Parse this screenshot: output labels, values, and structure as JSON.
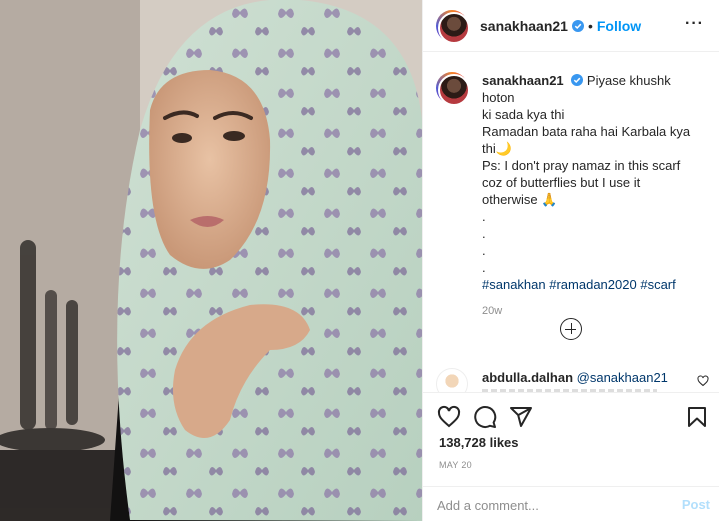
{
  "post": {
    "image_alt": "",
    "author": {
      "username": "sanakhaan21",
      "verified": true,
      "follow_label": "Follow",
      "separator": "•"
    },
    "caption": {
      "username": "sanakhaan21",
      "lines": [
        "Piyase khushk hoton",
        "ki sada kya thi",
        "Ramadan bata raha hai Karbala kya",
        "thi🌙",
        "Ps: I don't pray namaz in this scarf",
        "coz of butterflies but I use it",
        "otherwise 🙏",
        ".",
        ".",
        ".",
        "."
      ],
      "hashtags": [
        "#sanakhan",
        "#ramadan2020",
        "#scarf"
      ],
      "time": "20w"
    },
    "comments": [
      {
        "username": "abdulla.dalhan",
        "text": "@sanakhaan21"
      }
    ],
    "likes": "138,728 likes",
    "date": "MAY 20",
    "add_comment_placeholder": "Add a comment...",
    "post_label": "Post"
  },
  "colors": {
    "accent": "#0095f6",
    "link": "#00376b",
    "muted": "#8e8e8e",
    "post_disabled": "#b2dffc"
  },
  "icons": [
    "more-options-icon",
    "verified-badge-icon",
    "load-more-comments-icon",
    "heart-icon",
    "comment-icon",
    "share-icon",
    "bookmark-icon"
  ]
}
